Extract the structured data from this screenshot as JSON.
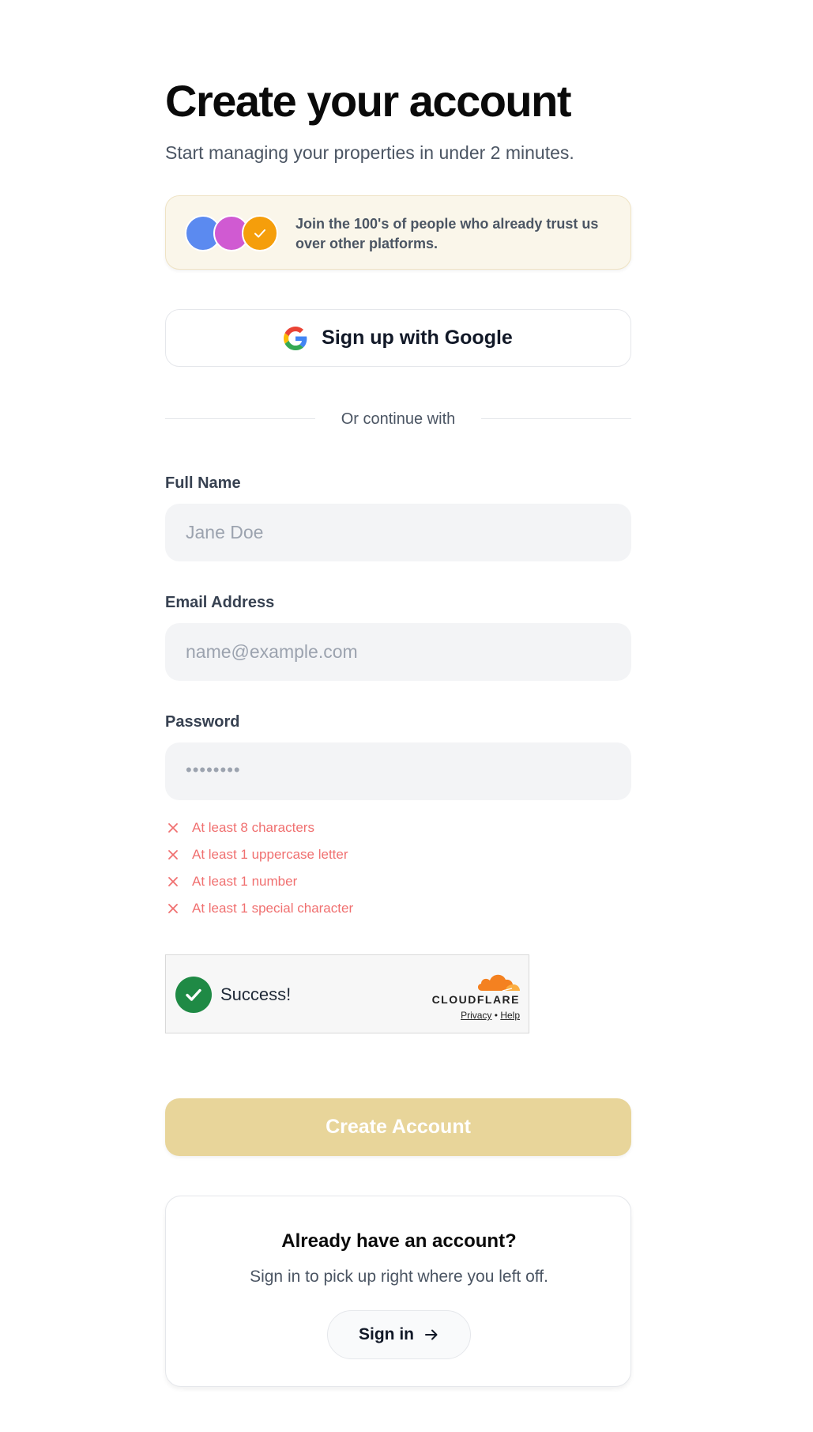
{
  "header": {
    "title": "Create your account",
    "subtitle": "Start managing your properties in under 2 minutes."
  },
  "trust_banner": {
    "text": "Join the 100's of people who already trust us over other platforms.",
    "avatar_colors": [
      "#5b8af0",
      "#d05ad2",
      "#f59e0b"
    ]
  },
  "google": {
    "label": "Sign up with Google",
    "icon": "google-icon"
  },
  "divider": {
    "text": "Or continue with"
  },
  "form": {
    "full_name": {
      "label": "Full Name",
      "placeholder": "Jane Doe",
      "value": ""
    },
    "email": {
      "label": "Email Address",
      "placeholder": "name@example.com",
      "value": ""
    },
    "password": {
      "label": "Password",
      "masked_value": "••••••••"
    }
  },
  "password_rules": [
    {
      "text": "At least 8 characters",
      "status": "unmet"
    },
    {
      "text": "At least 1 uppercase letter",
      "status": "unmet"
    },
    {
      "text": "At least 1 number",
      "status": "unmet"
    },
    {
      "text": "At least 1 special character",
      "status": "unmet"
    }
  ],
  "captcha": {
    "status": "Success!",
    "brand": "CLOUDFLARE",
    "privacy": "Privacy",
    "separator": "•",
    "help": "Help"
  },
  "submit": {
    "label": "Create Account",
    "disabled": true
  },
  "signin_card": {
    "title": "Already have an account?",
    "subtitle": "Sign in to pick up right where you left off.",
    "button_label": "Sign in",
    "button_icon": "arrow-right-icon"
  },
  "colors": {
    "accent_disabled": "#e8d59a",
    "error": "#f07070",
    "success": "#1f8a45",
    "banner_bg": "#faf6ea"
  }
}
